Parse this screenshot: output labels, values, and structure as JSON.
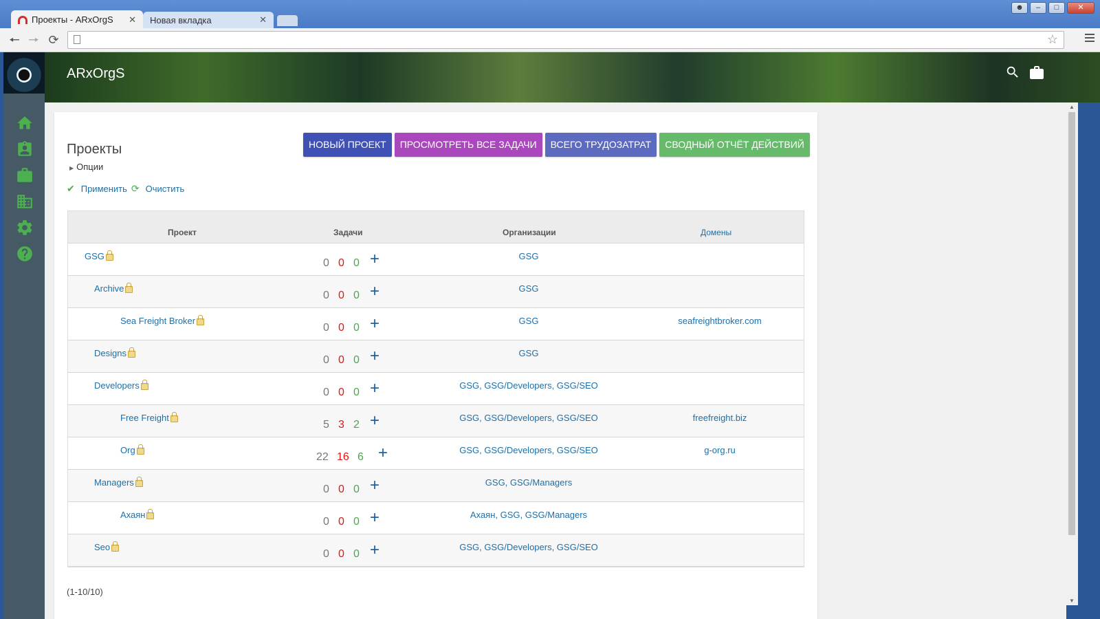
{
  "browser": {
    "tabs": [
      {
        "title": "Проекты - ARxOrgS",
        "close": "✕"
      },
      {
        "title": "Новая вкладка",
        "close": "✕"
      }
    ]
  },
  "app": {
    "brand": "ARxOrgS",
    "sidebar_icons": [
      "home-icon",
      "contact-card-icon",
      "briefcase-icon",
      "building-icon",
      "gear-icon",
      "help-icon"
    ],
    "header_icons": [
      "search-icon",
      "briefcase-icon"
    ],
    "accent": "#4caf50"
  },
  "page": {
    "title": "Проекты",
    "buttons": {
      "new_project": "НОВЫЙ ПРОЕКТ",
      "view_tasks": "ПРОСМОТРЕТЬ ВСЕ ЗАДАЧИ",
      "total_effort": "ВСЕГО ТРУДОЗАТРАТ",
      "summary_report": "СВОДНЫЙ ОТЧЁТ ДЕЙСТВИЙ"
    },
    "button_colors": {
      "new_project": "#3f51b5",
      "view_tasks": "#ab47bc",
      "total_effort": "#5c6bc0",
      "summary_report": "#66bb6a"
    },
    "options_label": "Опции",
    "apply_label": "Применить",
    "clear_label": "Очистить",
    "table": {
      "headers": {
        "project": "Проект",
        "tasks": "Задачи",
        "orgs": "Организации",
        "domains": "Домены"
      },
      "rows": [
        {
          "name": "GSG",
          "level": 0,
          "open": "0",
          "overdue": "0",
          "done": "0",
          "orgs": "GSG",
          "domain": ""
        },
        {
          "name": "Archive",
          "level": 1,
          "open": "0",
          "overdue": "0",
          "done": "0",
          "orgs": "GSG",
          "domain": ""
        },
        {
          "name": "Sea Freight Broker",
          "level": 2,
          "open": "0",
          "overdue": "0",
          "done": "0",
          "orgs": "GSG",
          "domain": "seafreightbroker.com"
        },
        {
          "name": "Designs",
          "level": 1,
          "open": "0",
          "overdue": "0",
          "done": "0",
          "orgs": "GSG",
          "domain": ""
        },
        {
          "name": "Developers",
          "level": 1,
          "open": "0",
          "overdue": "0",
          "done": "0",
          "orgs": "GSG, GSG/Developers, GSG/SEO",
          "domain": ""
        },
        {
          "name": "Free Freight",
          "level": 2,
          "open": "5",
          "overdue": "3",
          "done": "2",
          "orgs": "GSG, GSG/Developers, GSG/SEO",
          "domain": "freefreight.biz"
        },
        {
          "name": "Org",
          "level": 2,
          "open": "22",
          "overdue": "16",
          "done": "6",
          "orgs": "GSG, GSG/Developers, GSG/SEO",
          "domain": "g-org.ru"
        },
        {
          "name": "Managers",
          "level": 1,
          "open": "0",
          "overdue": "0",
          "done": "0",
          "orgs": "GSG, GSG/Managers",
          "domain": ""
        },
        {
          "name": "Ахаян",
          "level": 2,
          "open": "0",
          "overdue": "0",
          "done": "0",
          "orgs": "Ахаян, GSG, GSG/Managers",
          "domain": ""
        },
        {
          "name": "Seo",
          "level": 1,
          "open": "0",
          "overdue": "0",
          "done": "0",
          "orgs": "GSG, GSG/Developers, GSG/SEO",
          "domain": ""
        }
      ],
      "add_symbol": "+"
    },
    "pager": "(1-10/10)"
  }
}
